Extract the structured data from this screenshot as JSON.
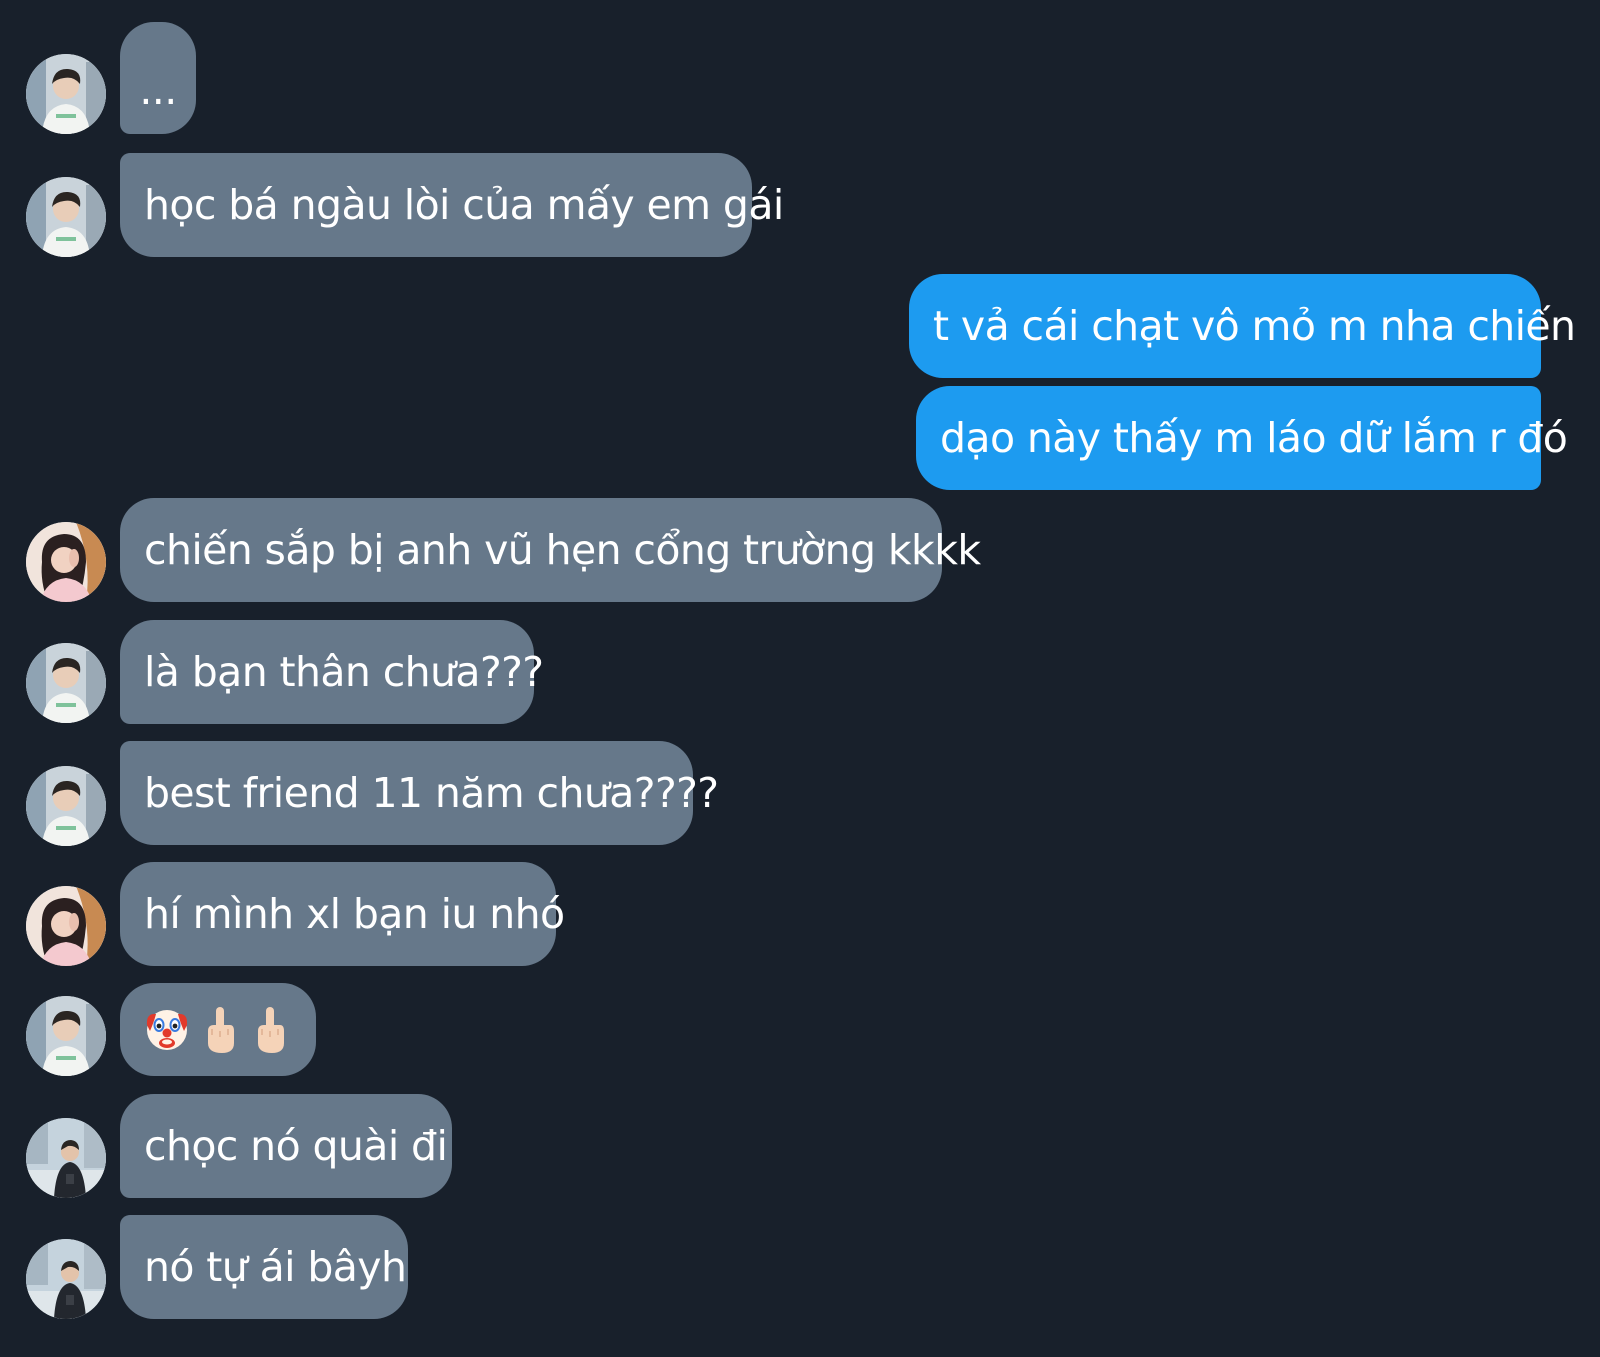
{
  "conversation": {
    "messages": [
      {
        "sender": "friend-a",
        "text": "..."
      },
      {
        "sender": "friend-a",
        "text": "học bá ngàu lòi của mấy em gái"
      },
      {
        "sender": "me",
        "text": "t vả cái chạt vô mỏ m nha chiến"
      },
      {
        "sender": "me",
        "text": "dạo này thấy m láo dữ lắm r đó"
      },
      {
        "sender": "friend-b",
        "text": "chiến sắp bị anh vũ hẹn cổng trường kkkk"
      },
      {
        "sender": "friend-a",
        "text": "là bạn thân chưa???"
      },
      {
        "sender": "friend-a",
        "text": "best friend 11 năm chưa????"
      },
      {
        "sender": "friend-b",
        "text": "hí mình xl bạn iu nhó"
      },
      {
        "sender": "friend-a",
        "emojis": [
          "clown-face",
          "middle-finger",
          "middle-finger"
        ]
      },
      {
        "sender": "friend-c",
        "text": "chọc nó quài đi"
      },
      {
        "sender": "friend-c",
        "text": "nó tự ái bâyh"
      }
    ]
  },
  "theme": {
    "background": "#18202b",
    "incoming_bubble": "#66788a",
    "outgoing_bubble": "#1d9bf0",
    "text": "#ffffff"
  }
}
